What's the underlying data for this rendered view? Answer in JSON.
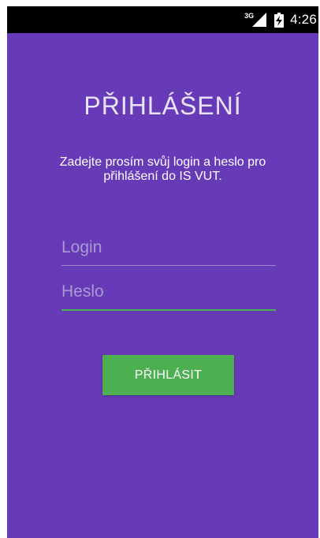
{
  "status_bar": {
    "network_label": "3G",
    "time": "4:26"
  },
  "title": "PŘIHLÁŠENÍ",
  "instructions": "Zadejte prosím svůj login a heslo pro přihlášení do IS VUT.",
  "login_field": {
    "value": "",
    "placeholder": "Login"
  },
  "password_field": {
    "value": "",
    "placeholder": "Heslo"
  },
  "login_button": {
    "label": "PŘIHLÁSIT"
  },
  "colors": {
    "background": "#673ab7",
    "status_bar": "#000000",
    "accent": "#4caf50",
    "text": "#ffffff"
  },
  "icons": {
    "signal": "cellular-signal-icon",
    "battery": "battery-charging-icon"
  }
}
